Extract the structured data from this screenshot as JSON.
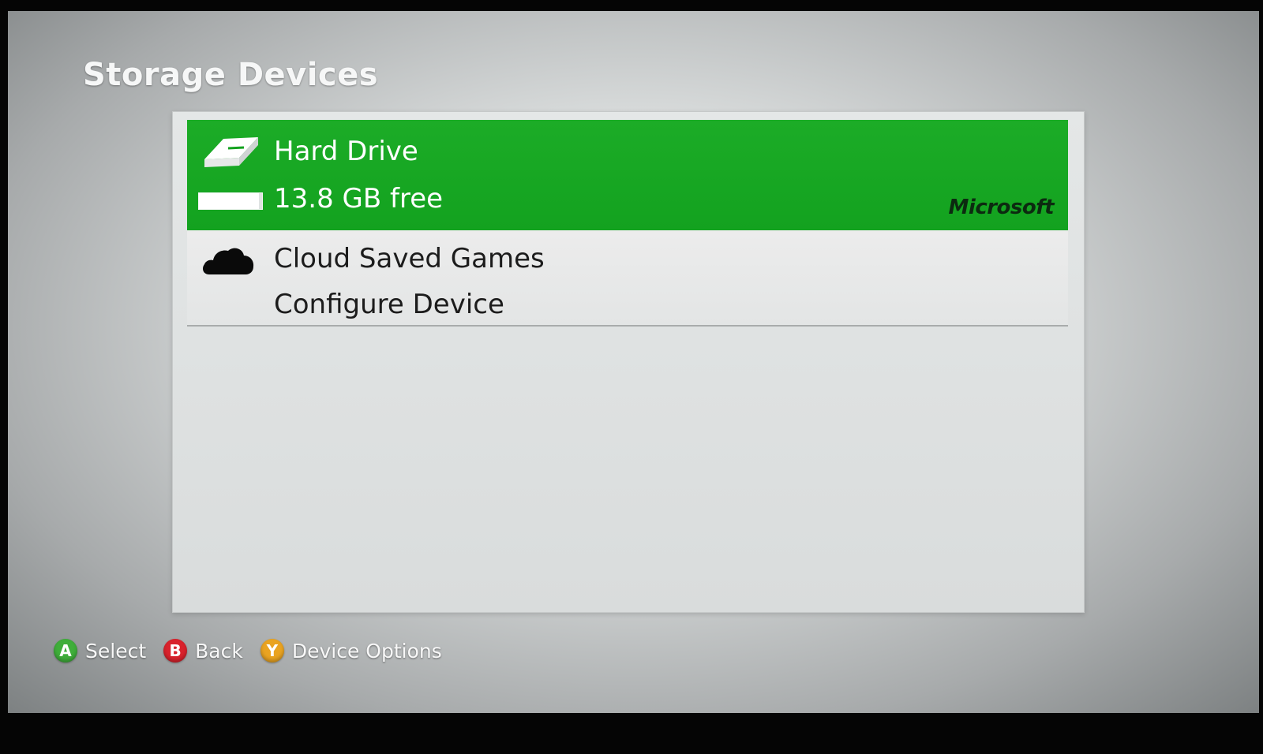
{
  "page": {
    "title": "Storage Devices"
  },
  "devices": [
    {
      "name": "Hard Drive",
      "detail": "13.8 GB free",
      "brand": "Microsoft",
      "icon": "hard-drive-icon",
      "selected": true,
      "free_fraction": 0.95
    },
    {
      "name": "Cloud Saved Games",
      "detail": "Configure Device",
      "icon": "cloud-icon",
      "selected": false
    }
  ],
  "footer": {
    "hints": [
      {
        "button": "A",
        "label": "Select",
        "color": "#3fae3a"
      },
      {
        "button": "B",
        "label": "Back",
        "color": "#d9222c"
      },
      {
        "button": "Y",
        "label": "Device Options",
        "color": "#e9a321"
      }
    ]
  },
  "colors": {
    "accent": "#13a21f",
    "panel": "#dfe2e2"
  }
}
